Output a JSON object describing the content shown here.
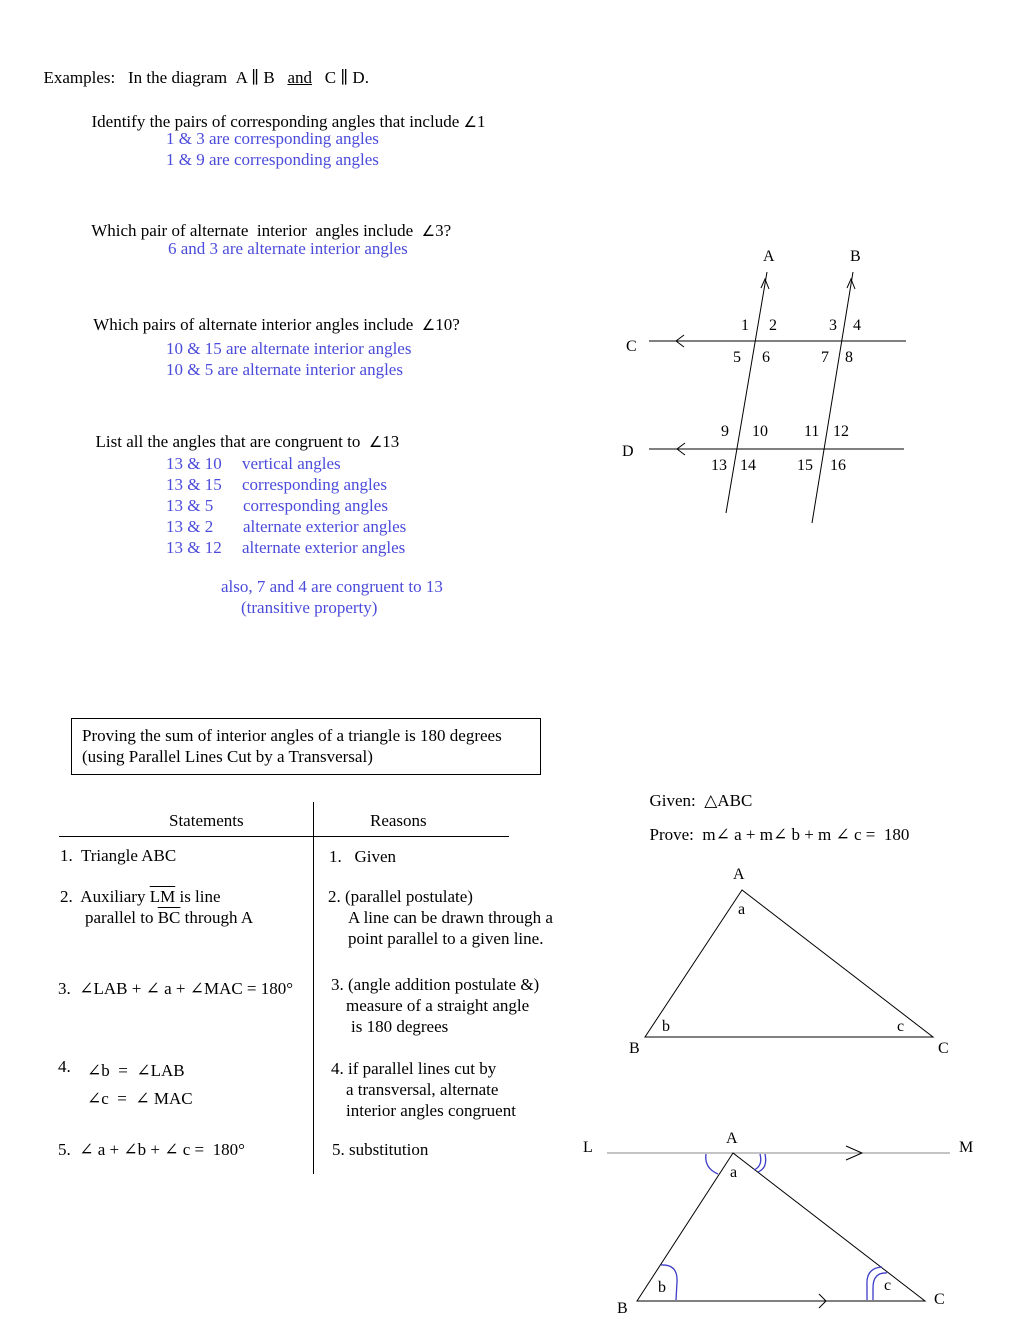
{
  "header": {
    "examples_label": "Examples:",
    "intro": "In the diagram",
    "parallel_1": "A ∥ B",
    "and": "and",
    "parallel_2": "C ∥ D."
  },
  "questions": [
    {
      "prompt": "Identify the pairs of corresponding angles that include",
      "angle_ref": "1",
      "answers": [
        "1 & 3 are corresponding angles",
        "1 & 9 are corresponding angles"
      ]
    },
    {
      "prompt": "Which pair of alternate  interior  angles include",
      "angle_ref": "3?",
      "answers": [
        "6 and 3 are alternate interior angles"
      ]
    },
    {
      "prompt": "Which pairs of alternate interior angles include",
      "angle_ref": "10?",
      "answers": [
        "10 & 15 are alternate interior angles",
        "10 & 5 are alternate interior angles"
      ]
    },
    {
      "prompt": "List all the angles that are congruent to",
      "angle_ref": "13",
      "congruent_pairs": [
        {
          "pair": "13 & 10",
          "reason": "vertical angles"
        },
        {
          "pair": "13 & 15",
          "reason": "corresponding angles"
        },
        {
          "pair": "13 & 5",
          "reason": "corresponding angles"
        },
        {
          "pair": "13 & 2",
          "reason": "alternate exterior angles"
        },
        {
          "pair": "13 & 12",
          "reason": "alternate exterior angles"
        }
      ],
      "note_line1": "also, 7 and 4 are congruent to 13",
      "note_line2": "(transitive property)"
    }
  ],
  "diagram1": {
    "line_labels": {
      "A": "A",
      "B": "B",
      "C": "C",
      "D": "D"
    },
    "angle_numbers": [
      "1",
      "2",
      "3",
      "4",
      "5",
      "6",
      "7",
      "8",
      "9",
      "10",
      "11",
      "12",
      "13",
      "14",
      "15",
      "16"
    ]
  },
  "proof": {
    "title_line1": "Proving the sum of interior angles of a triangle is 180 degrees",
    "title_line2": "(using Parallel Lines Cut by a Transversal)",
    "given_label": "Given:",
    "given_value": "△ABC",
    "prove_label": "Prove:",
    "prove_value": "m∠ a + m∠ b + m ∠ c =  180",
    "statements_header": "Statements",
    "reasons_header": "Reasons",
    "steps": [
      {
        "statement_lines": [
          "1.  Triangle ABC"
        ],
        "reason_lines": [
          "1.   Given"
        ]
      },
      {
        "statement_pre": "2.  Auxiliary ",
        "statement_seg1": "LM",
        "statement_mid": " is line",
        "statement_line2_pre": "parallel to ",
        "statement_seg2": "BC",
        "statement_line2_post": " through A",
        "reason_lines": [
          "2. (parallel postulate)",
          "A line can be drawn through a",
          "point parallel to a given line."
        ]
      },
      {
        "statement_lines": [
          "3.  ∠LAB + ∠ a + ∠MAC = 180°"
        ],
        "reason_lines": [
          "3. (angle addition postulate &)",
          "measure of a straight angle",
          "is 180 degrees"
        ]
      },
      {
        "statement_lines": [
          "4.",
          "∠b  =  ∠LAB",
          "∠c  =  ∠ MAC"
        ],
        "reason_lines": [
          "4. if parallel lines cut by",
          "a transversal, alternate",
          "interior angles congruent"
        ]
      },
      {
        "statement_lines": [
          "5.  ∠ a + ∠b + ∠ c =  180°"
        ],
        "reason_lines": [
          "5. substitution"
        ]
      }
    ]
  },
  "triangle1": {
    "A": "A",
    "B": "B",
    "C": "C",
    "a": "a",
    "b": "b",
    "c": "c"
  },
  "triangle2": {
    "L": "L",
    "M": "M",
    "A": "A",
    "B": "B",
    "C": "C",
    "a": "a",
    "b": "b",
    "c": "c"
  },
  "colors": {
    "answer_blue": "#4b4bdb",
    "arc_blue": "#3c3cc8",
    "line_gray": "#888888"
  }
}
